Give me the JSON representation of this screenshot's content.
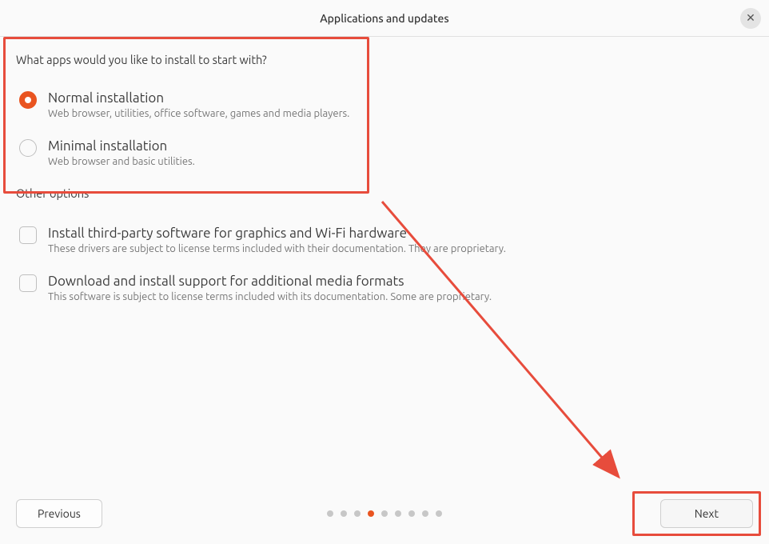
{
  "header": {
    "title": "Applications and updates"
  },
  "section1": {
    "title": "What apps would you like to install to start with?",
    "option_normal": {
      "label": "Normal installation",
      "desc": "Web browser, utilities, office software, games and media players."
    },
    "option_minimal": {
      "label": "Minimal installation",
      "desc": "Web browser and basic utilities."
    }
  },
  "section2": {
    "title": "Other options",
    "option_thirdparty": {
      "label": "Install third-party software for graphics and Wi-Fi hardware",
      "desc": "These drivers are subject to license terms included with their documentation. They are proprietary."
    },
    "option_media": {
      "label": "Download and install support for additional media formats",
      "desc": "This software is subject to license terms included with its documentation. Some are proprietary."
    }
  },
  "footer": {
    "previous": "Previous",
    "next": "Next"
  },
  "pager": {
    "total": 9,
    "active_index": 3
  }
}
